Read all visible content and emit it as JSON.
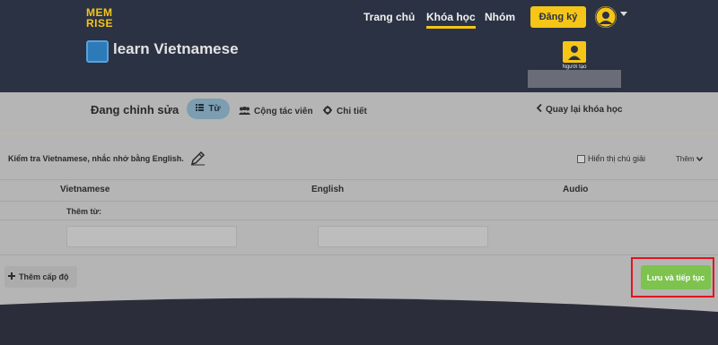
{
  "header": {
    "logo_line1": "MEM",
    "logo_line2": "RISE",
    "nav": {
      "home": "Trang chủ",
      "courses": "Khóa học",
      "groups": "Nhóm"
    },
    "signup_label": "Đăng ký",
    "course_title": "learn Vietnamese",
    "creator_label": "Người tạo"
  },
  "toolbar": {
    "editing_label": "Đang chỉnh sửa",
    "tabs": {
      "words": "Từ",
      "contributors": "Cộng tác viên",
      "details": "Chi tiết"
    },
    "back_label": "Quay lại khóa học"
  },
  "level": {
    "instruction": "Kiểm tra Vietnamese, nhắc nhở bằng English.",
    "show_notes_label": "Hiển thị chú giải",
    "more_label": "Thêm",
    "columns": {
      "vietnamese": "Vietnamese",
      "english": "English",
      "audio": "Audio"
    },
    "add_word_label": "Thêm từ:"
  },
  "footer": {
    "add_level_label": "Thêm cấp độ",
    "save_label": "Lưu và tiếp tục"
  },
  "colors": {
    "brand": "#f5c518",
    "header_bg": "#2b3243",
    "save_green": "#7dc34e",
    "highlight_red": "#e4141d"
  }
}
